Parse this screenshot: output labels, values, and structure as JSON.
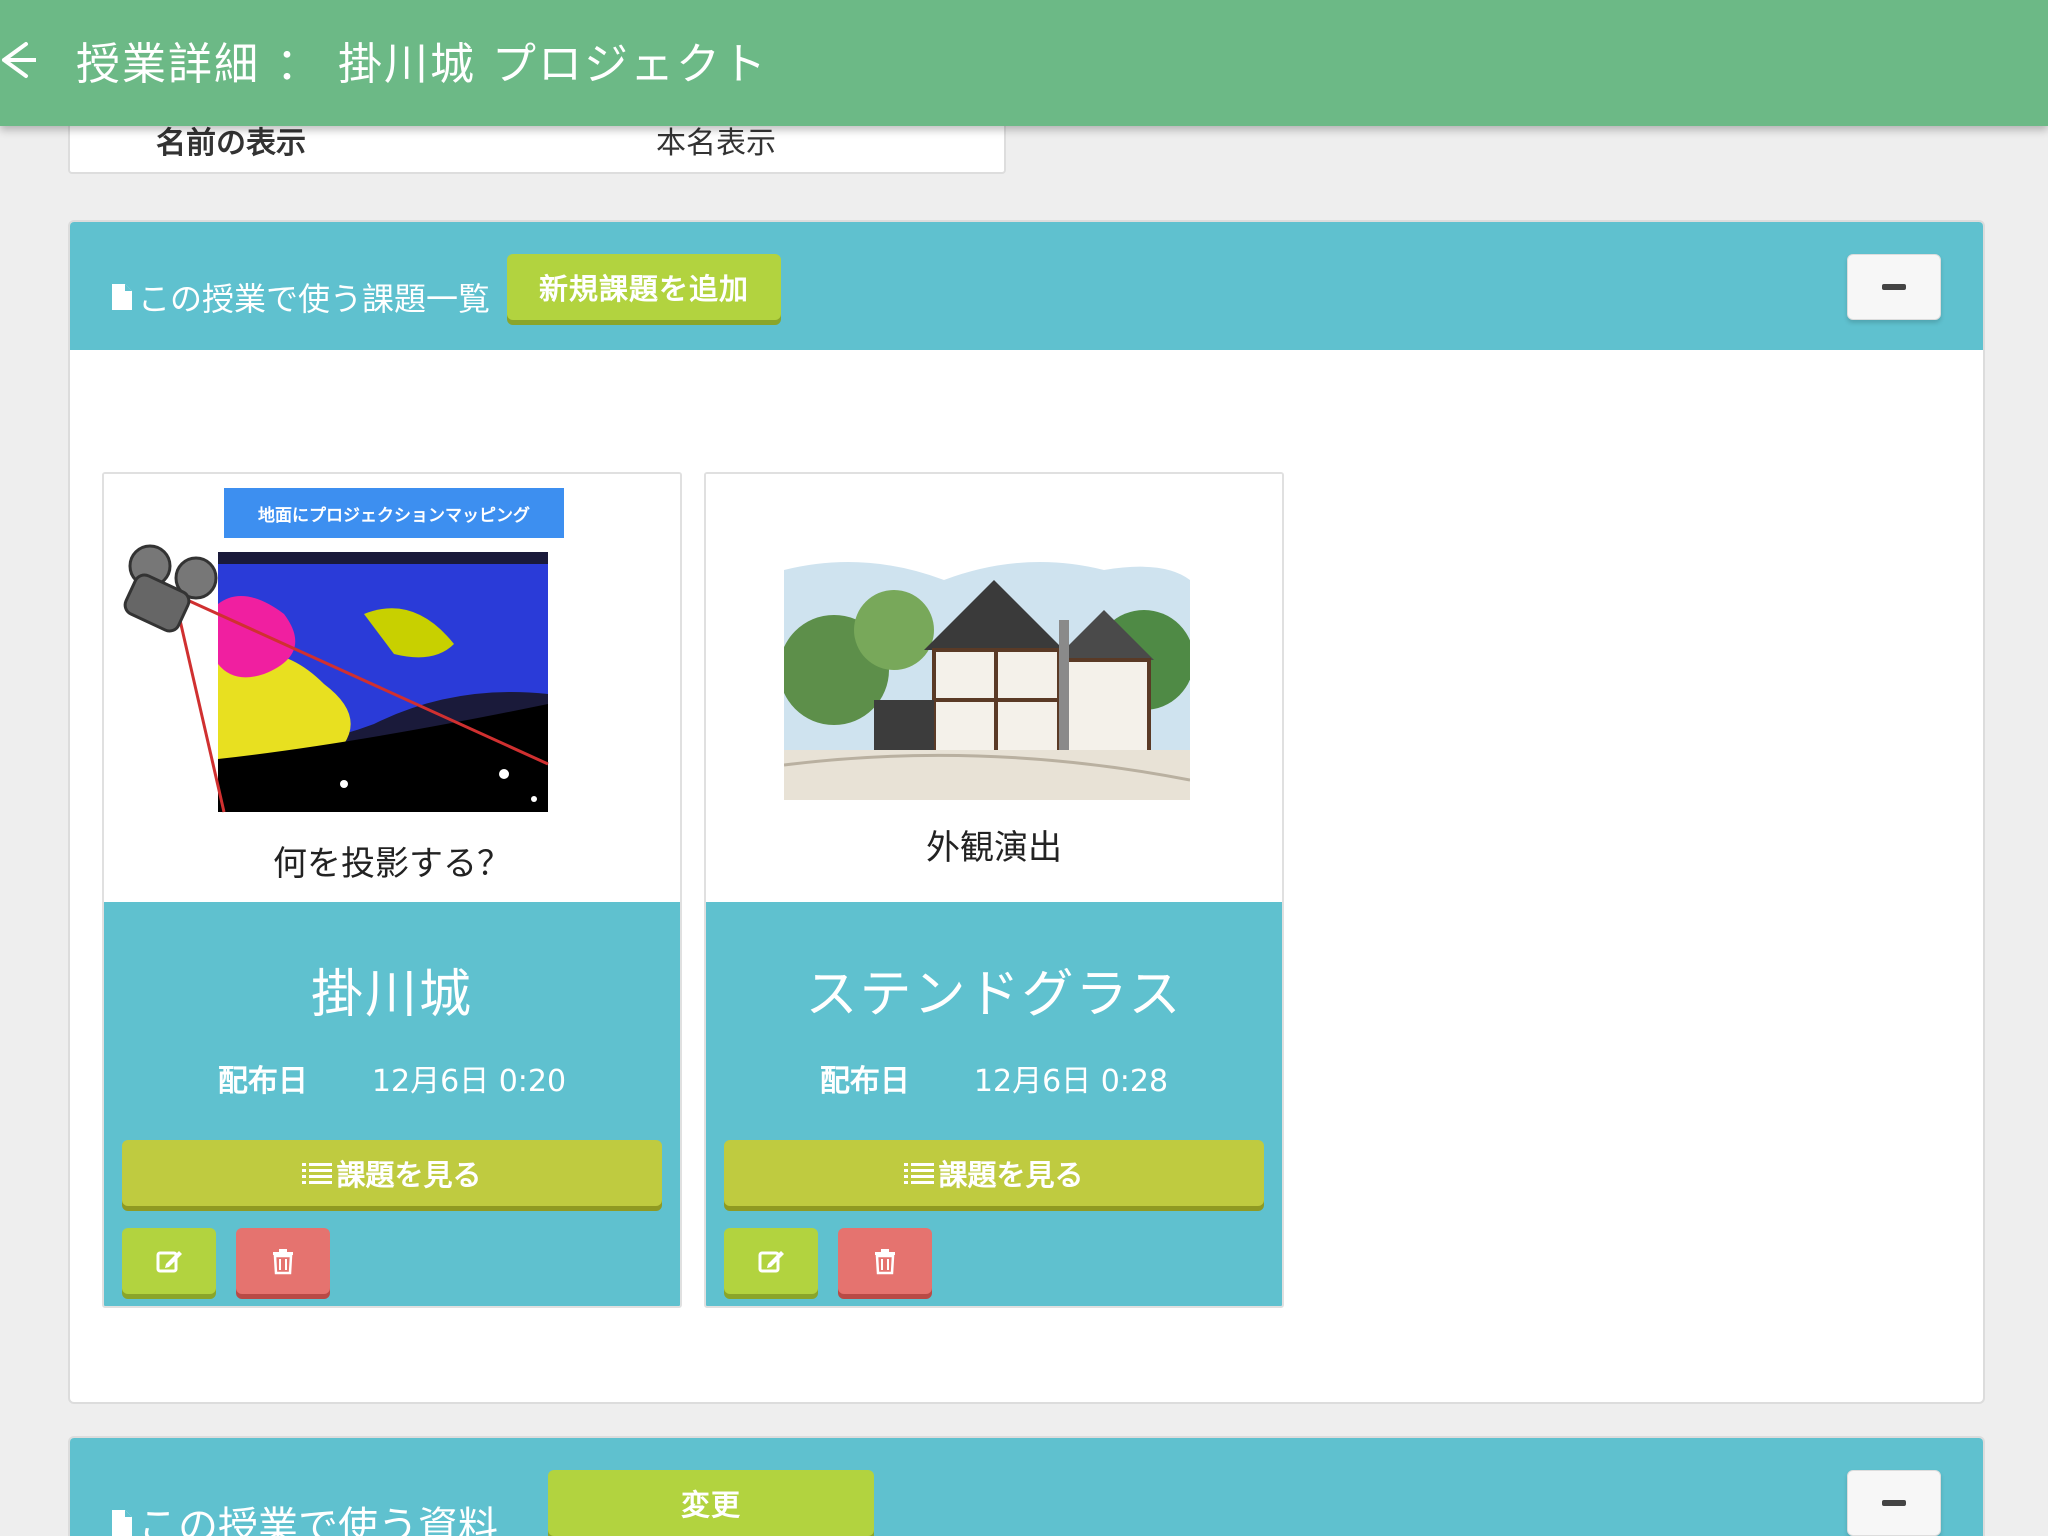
{
  "appbar": {
    "title": "授業詳細 ： 掛川城 プロジェクト",
    "back_icon": "arrow-left-icon",
    "color": "#6cb986"
  },
  "info_panel": {
    "label": "名前の表示",
    "value": "本名表示"
  },
  "tasks_panel": {
    "title": "この授業で使う課題一覧",
    "add_button_label": "新規課題を追加",
    "collapse_icon": "minus-icon",
    "header_color": "#5fc1cf",
    "cards": [
      {
        "banner_text": "地面にプロジェクションマッピング",
        "caption": "何を投影する？",
        "title": "掛川城",
        "dist_label": "配布日",
        "dist_date": "12月6日 0:20",
        "view_button_label": "課題を見る"
      },
      {
        "caption": "外観演出",
        "title": "ステンドグラス",
        "dist_label": "配布日",
        "dist_date": "12月6日 0:28",
        "view_button_label": "課題を見る"
      }
    ]
  },
  "materials_panel": {
    "title": "この授業で使う資料",
    "change_button_label": "変更",
    "collapse_icon": "minus-icon"
  },
  "colors": {
    "accent_green": "#b2d33f",
    "delete_red": "#e5736f",
    "view_olive": "#bfcb40"
  }
}
